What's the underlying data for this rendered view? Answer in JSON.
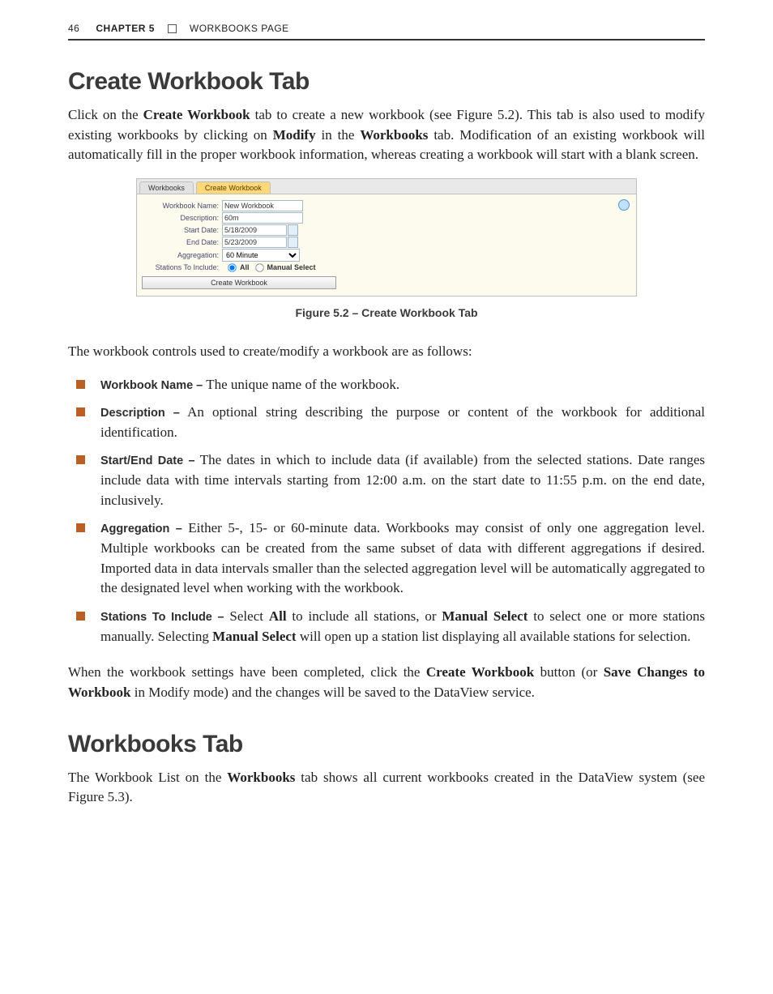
{
  "header": {
    "page_number": "46",
    "chapter_label": "CHAPTER 5",
    "chapter_subtitle": "WORKBOOKS PAGE"
  },
  "section1": {
    "title": "Create Workbook Tab",
    "intro_pre": "Click on the ",
    "intro_bold1": "Create Workbook",
    "intro_mid1": " tab to create a new workbook (see Figure 5.2). This tab is also used to modify existing workbooks by clicking on ",
    "intro_bold2": "Modify",
    "intro_mid2": " in the ",
    "intro_bold3": "Workbooks",
    "intro_post": " tab. Modification of an existing workbook will automatically fill in the proper workbook information, whereas creating a workbook will start with a blank screen."
  },
  "figure52": {
    "tabs": {
      "workbooks": "Workbooks",
      "create": "Create Workbook"
    },
    "labels": {
      "name": "Workbook Name:",
      "desc": "Description:",
      "start": "Start Date:",
      "end": "End Date:",
      "agg": "Aggregation:",
      "stations": "Stations To Include:"
    },
    "values": {
      "name": "New Workbook",
      "desc": "60m",
      "start": "5/18/2009",
      "end": "5/23/2009",
      "agg": "60 Minute"
    },
    "radios": {
      "all": "All",
      "manual": "Manual Select"
    },
    "button": "Create Workbook",
    "caption": "Figure 5.2 – Create Workbook Tab"
  },
  "controls_intro": "The workbook controls used to create/modify a workbook are as follows:",
  "bullets": {
    "b1_term": "Workbook Name –",
    "b1_body": " The unique name of the workbook.",
    "b2_term": "Description –",
    "b2_body": " An optional string describing the purpose or content of the workbook for additional identification.",
    "b3_term": "Start/End Date –",
    "b3_body": " The dates in which to include data (if available) from the selected stations. Date ranges include data with time intervals starting from 12:00 a.m. on the start date to 11:55 p.m. on the end date, inclusively.",
    "b4_term": "Aggregation –",
    "b4_body": " Either 5-, 15- or 60-minute data. Workbooks may consist of only one aggregation level. Multiple workbooks can be created from the same subset of data with different aggregations if desired. Imported data in data intervals smaller than the selected aggregation level will be automatically aggregated to the designated level when working with the workbook.",
    "b5_term": "Stations To Include –",
    "b5_pre": " Select ",
    "b5_bold1": "All",
    "b5_mid1": " to include all stations, or ",
    "b5_bold2": "Manual Select",
    "b5_mid2": " to select one or more stations manually. Selecting ",
    "b5_bold3": "Manual Select",
    "b5_post": " will open up a station list displaying all available stations for selection."
  },
  "closing": {
    "pre": "When the workbook settings have been completed, click the ",
    "bold1": "Create Workbook",
    "mid1": " button (or ",
    "bold2": "Save Changes to Workbook",
    "post": " in Modify mode) and the changes will be saved to the DataView service."
  },
  "section2": {
    "title": "Workbooks Tab",
    "body_pre": "The Workbook List on the ",
    "body_bold": "Workbooks",
    "body_post": " tab shows all current workbooks created in the DataView system (see Figure 5.3)."
  }
}
